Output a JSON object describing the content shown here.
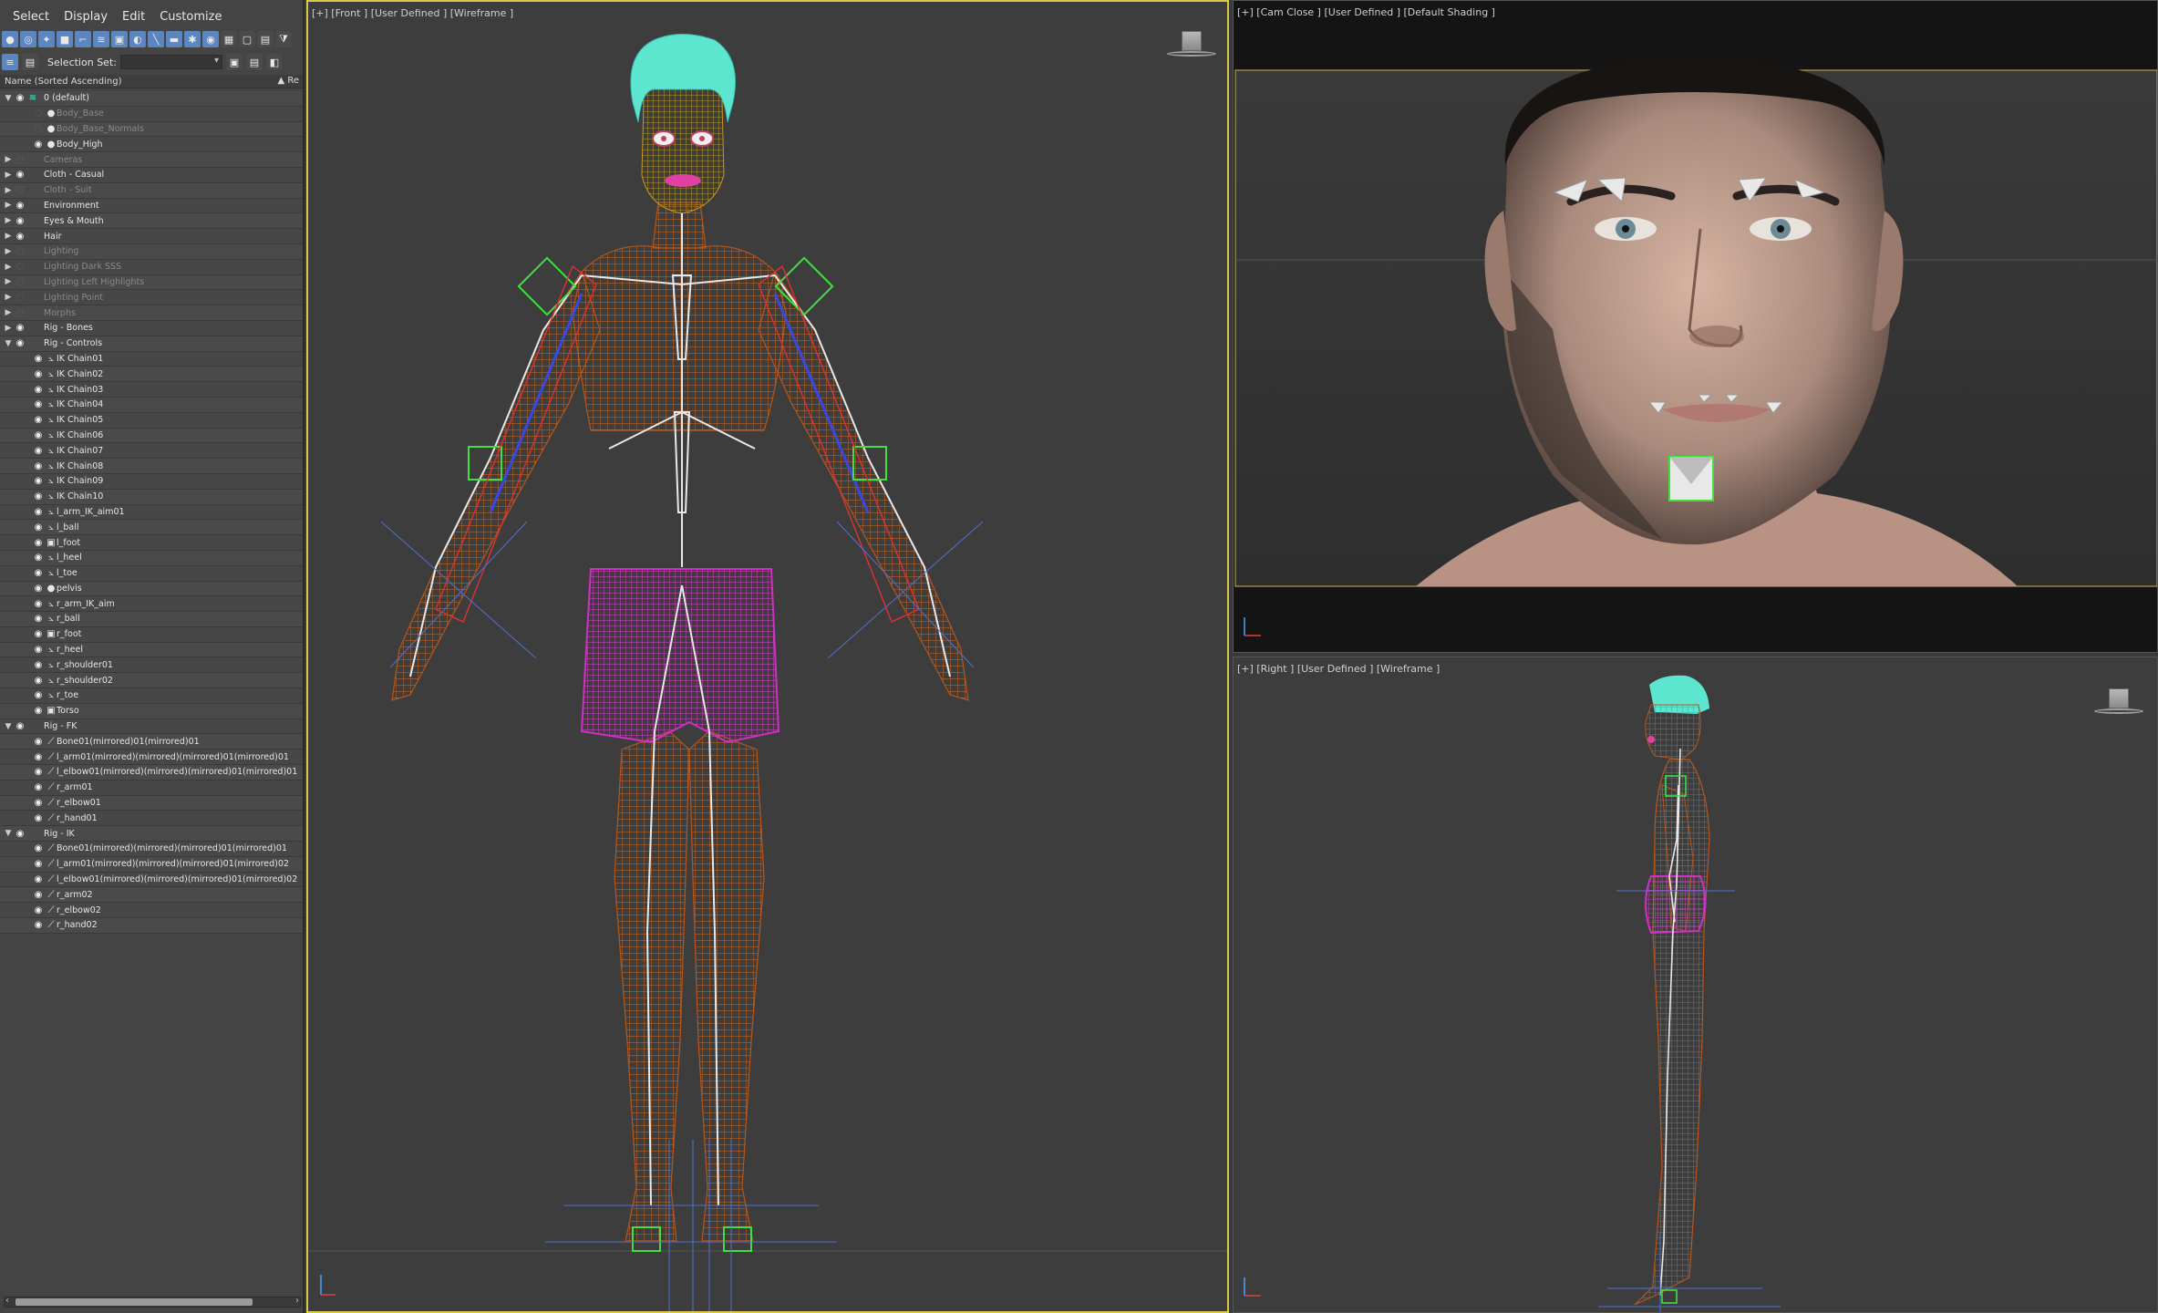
{
  "menu": [
    "Select",
    "Display",
    "Edit",
    "Customize"
  ],
  "toolbar": {
    "selection_set_label": "Selection Set:",
    "selection_set_value": ""
  },
  "columns": {
    "name": "Name (Sorted Ascending)",
    "right": "▲ Re"
  },
  "tree": [
    {
      "label": "0 (default)",
      "level": 0,
      "expand": "open",
      "eye": true,
      "icon": "layer-icon",
      "dim": false
    },
    {
      "label": "Body_Base",
      "level": 1,
      "expand": "",
      "eye": false,
      "icon": "sphere-icon",
      "dim": true
    },
    {
      "label": "Body_Base_Normals",
      "level": 1,
      "expand": "",
      "eye": false,
      "icon": "sphere-icon",
      "dim": true
    },
    {
      "label": "Body_High",
      "level": 1,
      "expand": "",
      "eye": true,
      "icon": "sphere-icon",
      "dim": false
    },
    {
      "label": "Cameras",
      "level": 0,
      "expand": "closed",
      "eye": false,
      "icon": "",
      "dim": true
    },
    {
      "label": "Cloth - Casual",
      "level": 0,
      "expand": "closed",
      "eye": true,
      "icon": "",
      "dim": false
    },
    {
      "label": "Cloth - Suit",
      "level": 0,
      "expand": "closed",
      "eye": false,
      "icon": "",
      "dim": true
    },
    {
      "label": "Environment",
      "level": 0,
      "expand": "closed",
      "eye": true,
      "icon": "",
      "dim": false
    },
    {
      "label": "Eyes & Mouth",
      "level": 0,
      "expand": "closed",
      "eye": true,
      "icon": "",
      "dim": false
    },
    {
      "label": "Hair",
      "level": 0,
      "expand": "closed",
      "eye": true,
      "icon": "",
      "dim": false
    },
    {
      "label": "Lighting",
      "level": 0,
      "expand": "closed",
      "eye": false,
      "icon": "",
      "dim": true
    },
    {
      "label": "Lighting Dark SSS",
      "level": 0,
      "expand": "closed",
      "eye": false,
      "icon": "",
      "dim": true
    },
    {
      "label": "Lighting Left Highlights",
      "level": 0,
      "expand": "closed",
      "eye": false,
      "icon": "",
      "dim": true
    },
    {
      "label": "Lighting Point",
      "level": 0,
      "expand": "closed",
      "eye": false,
      "icon": "",
      "dim": true
    },
    {
      "label": "Morphs",
      "level": 0,
      "expand": "closed",
      "eye": false,
      "icon": "",
      "dim": true
    },
    {
      "label": "Rig - Bones",
      "level": 0,
      "expand": "closed",
      "eye": true,
      "icon": "",
      "dim": false
    },
    {
      "label": "Rig - Controls",
      "level": 0,
      "expand": "open",
      "eye": true,
      "icon": "",
      "dim": false
    },
    {
      "label": "IK Chain01",
      "level": 1,
      "expand": "",
      "eye": true,
      "icon": "ik-icon",
      "dim": false
    },
    {
      "label": "IK Chain02",
      "level": 1,
      "expand": "",
      "eye": true,
      "icon": "ik-icon",
      "dim": false
    },
    {
      "label": "IK Chain03",
      "level": 1,
      "expand": "",
      "eye": true,
      "icon": "ik-icon",
      "dim": false
    },
    {
      "label": "IK Chain04",
      "level": 1,
      "expand": "",
      "eye": true,
      "icon": "ik-icon",
      "dim": false
    },
    {
      "label": "IK Chain05",
      "level": 1,
      "expand": "",
      "eye": true,
      "icon": "ik-icon",
      "dim": false
    },
    {
      "label": "IK Chain06",
      "level": 1,
      "expand": "",
      "eye": true,
      "icon": "ik-icon",
      "dim": false
    },
    {
      "label": "IK Chain07",
      "level": 1,
      "expand": "",
      "eye": true,
      "icon": "ik-icon",
      "dim": false
    },
    {
      "label": "IK Chain08",
      "level": 1,
      "expand": "",
      "eye": true,
      "icon": "ik-icon",
      "dim": false
    },
    {
      "label": "IK Chain09",
      "level": 1,
      "expand": "",
      "eye": true,
      "icon": "ik-icon",
      "dim": false
    },
    {
      "label": "IK Chain10",
      "level": 1,
      "expand": "",
      "eye": true,
      "icon": "ik-icon",
      "dim": false
    },
    {
      "label": "l_arm_IK_aim01",
      "level": 1,
      "expand": "",
      "eye": true,
      "icon": "ik-icon",
      "dim": false
    },
    {
      "label": "l_ball",
      "level": 1,
      "expand": "",
      "eye": true,
      "icon": "ik-icon",
      "dim": false
    },
    {
      "label": "l_foot",
      "level": 1,
      "expand": "",
      "eye": true,
      "icon": "helper-icon",
      "dim": false
    },
    {
      "label": "l_heel",
      "level": 1,
      "expand": "",
      "eye": true,
      "icon": "ik-icon",
      "dim": false
    },
    {
      "label": "l_toe",
      "level": 1,
      "expand": "",
      "eye": true,
      "icon": "ik-icon",
      "dim": false
    },
    {
      "label": "pelvis",
      "level": 1,
      "expand": "",
      "eye": true,
      "icon": "sphere-icon",
      "dim": false
    },
    {
      "label": "r_arm_IK_aim",
      "level": 1,
      "expand": "",
      "eye": true,
      "icon": "ik-icon",
      "dim": false
    },
    {
      "label": "r_ball",
      "level": 1,
      "expand": "",
      "eye": true,
      "icon": "ik-icon",
      "dim": false
    },
    {
      "label": "r_foot",
      "level": 1,
      "expand": "",
      "eye": true,
      "icon": "helper-icon",
      "dim": false
    },
    {
      "label": "r_heel",
      "level": 1,
      "expand": "",
      "eye": true,
      "icon": "ik-icon",
      "dim": false
    },
    {
      "label": "r_shoulder01",
      "level": 1,
      "expand": "",
      "eye": true,
      "icon": "ik-icon",
      "dim": false
    },
    {
      "label": "r_shoulder02",
      "level": 1,
      "expand": "",
      "eye": true,
      "icon": "ik-icon",
      "dim": false
    },
    {
      "label": "r_toe",
      "level": 1,
      "expand": "",
      "eye": true,
      "icon": "ik-icon",
      "dim": false
    },
    {
      "label": "Torso",
      "level": 1,
      "expand": "",
      "eye": true,
      "icon": "helper-icon",
      "dim": false
    },
    {
      "label": "Rig - FK",
      "level": 0,
      "expand": "open",
      "eye": true,
      "icon": "",
      "dim": false
    },
    {
      "label": "Bone01(mirrored)01(mirrored)01",
      "level": 1,
      "expand": "",
      "eye": true,
      "icon": "bone-icon",
      "dim": false
    },
    {
      "label": "l_arm01(mirrored)(mirrored)(mirrored)01(mirrored)01",
      "level": 1,
      "expand": "",
      "eye": true,
      "icon": "bone-icon",
      "dim": false
    },
    {
      "label": "l_elbow01(mirrored)(mirrored)(mirrored)01(mirrored)01",
      "level": 1,
      "expand": "",
      "eye": true,
      "icon": "bone-icon",
      "dim": false
    },
    {
      "label": "r_arm01",
      "level": 1,
      "expand": "",
      "eye": true,
      "icon": "bone-icon",
      "dim": false
    },
    {
      "label": "r_elbow01",
      "level": 1,
      "expand": "",
      "eye": true,
      "icon": "bone-icon",
      "dim": false
    },
    {
      "label": "r_hand01",
      "level": 1,
      "expand": "",
      "eye": true,
      "icon": "bone-icon",
      "dim": false
    },
    {
      "label": "Rig - IK",
      "level": 0,
      "expand": "open",
      "eye": true,
      "icon": "",
      "dim": false
    },
    {
      "label": "Bone01(mirrored)(mirrored)(mirrored)01(mirrored)01",
      "level": 1,
      "expand": "",
      "eye": true,
      "icon": "bone-icon",
      "dim": false
    },
    {
      "label": "l_arm01(mirrored)(mirrored)(mirrored)01(mirrored)02",
      "level": 1,
      "expand": "",
      "eye": true,
      "icon": "bone-icon",
      "dim": false
    },
    {
      "label": "l_elbow01(mirrored)(mirrored)(mirrored)01(mirrored)02",
      "level": 1,
      "expand": "",
      "eye": true,
      "icon": "bone-icon",
      "dim": false
    },
    {
      "label": "r_arm02",
      "level": 1,
      "expand": "",
      "eye": true,
      "icon": "bone-icon",
      "dim": false
    },
    {
      "label": "r_elbow02",
      "level": 1,
      "expand": "",
      "eye": true,
      "icon": "bone-icon",
      "dim": false
    },
    {
      "label": "r_hand02",
      "level": 1,
      "expand": "",
      "eye": true,
      "icon": "bone-icon",
      "dim": false
    }
  ],
  "viewports": {
    "front": "[+] [Front ] [User Defined ] [Wireframe ]",
    "cam": "[+] [Cam Close ] [User Defined ] [Default Shading ]",
    "right": "[+] [Right ] [User Defined ] [Wireframe ]"
  },
  "colors": {
    "accent": "#5b86c1",
    "active_viewport_border": "#d8c84a",
    "wire_body": "#c8651e",
    "wire_shorts": "#d030c0",
    "wire_hair": "#5ce6d0",
    "bones": "#e8e8e8"
  }
}
